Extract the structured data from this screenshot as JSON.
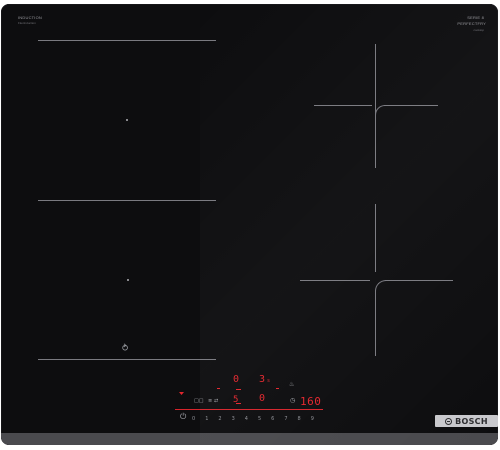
{
  "branding": {
    "left_title": "INDUCTION",
    "left_subtitle": "FlexInduction",
    "right_title_line1": "SERIE 8",
    "right_title_line2": "PERFECTFRY",
    "right_subtitle": "cooktop",
    "brand": "BOSCH"
  },
  "display": {
    "zone_top_value": "0",
    "zone_level": "3",
    "zone_level_suffix": "s",
    "zone_bottom_left": "5",
    "zone_bottom_value": "0",
    "timer": "160",
    "timer_unit": "Ø"
  },
  "controls": {
    "scale": [
      "0",
      "1",
      "2",
      "3",
      "4",
      "5",
      "6",
      "7",
      "8",
      "9"
    ],
    "power_icon": "power-icon",
    "flex_icon": "flex-zone-icon",
    "fry_icon": "frying-sensor-icon",
    "timer_icon": "timer-icon",
    "lock_icon": "child-lock-icon"
  },
  "colors": {
    "glass": "#0d0d0f",
    "led": "#e3262d",
    "bezel": "#4a4a4e"
  }
}
